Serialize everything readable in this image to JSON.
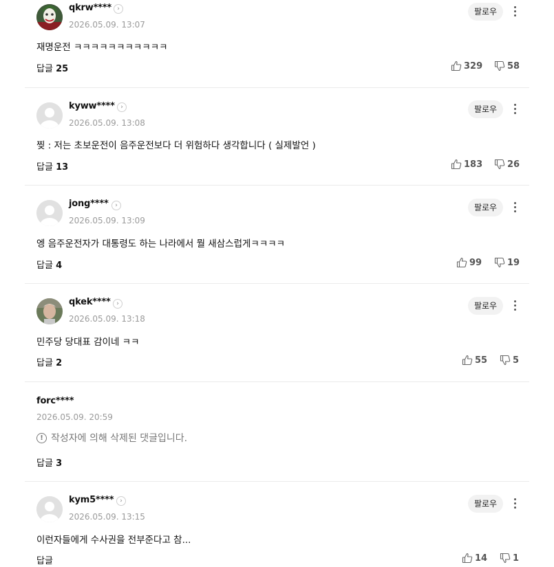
{
  "follow_label": "팔로우",
  "reply_label": "답글",
  "comments": [
    {
      "user": "qkrw****",
      "date": "2026.05.09. 13:07",
      "text": "재명운전 ㅋㅋㅋㅋㅋㅋㅋㅋㅋㅋㅋ",
      "replies": "25",
      "likes": "329",
      "dislikes": "58",
      "avatar": "joker-avatar"
    },
    {
      "user": "kyww****",
      "date": "2026.05.09. 13:08",
      "text": "찢 : 저는 초보운전이 음주운전보다 더 위험하다 생각합니다 ( 실제발언 )",
      "replies": "13",
      "likes": "183",
      "dislikes": "26",
      "avatar": "default-avatar"
    },
    {
      "user": "jong****",
      "date": "2026.05.09. 13:09",
      "text": "엥 음주운전자가 대통령도 하는 나라에서 뭘 새삼스럽게ㅋㅋㅋㅋ",
      "replies": "4",
      "likes": "99",
      "dislikes": "19",
      "avatar": "default-avatar"
    },
    {
      "user": "qkek****",
      "date": "2026.05.09. 13:18",
      "text": "민주당 당대표 감이네 ㅋㅋ",
      "replies": "2",
      "likes": "55",
      "dislikes": "5",
      "avatar": "photo-avatar"
    },
    {
      "user": "forc****",
      "date": "2026.05.09. 20:59",
      "deleted_text": "작성자에 의해 삭제된 댓글입니다.",
      "replies": "3"
    },
    {
      "user": "kym5****",
      "date": "2026.05.09. 13:15",
      "text": "이런자들에게 수사권을 전부준다고 참...",
      "replies": "",
      "likes": "14",
      "dislikes": "1",
      "avatar": "default-avatar"
    }
  ]
}
